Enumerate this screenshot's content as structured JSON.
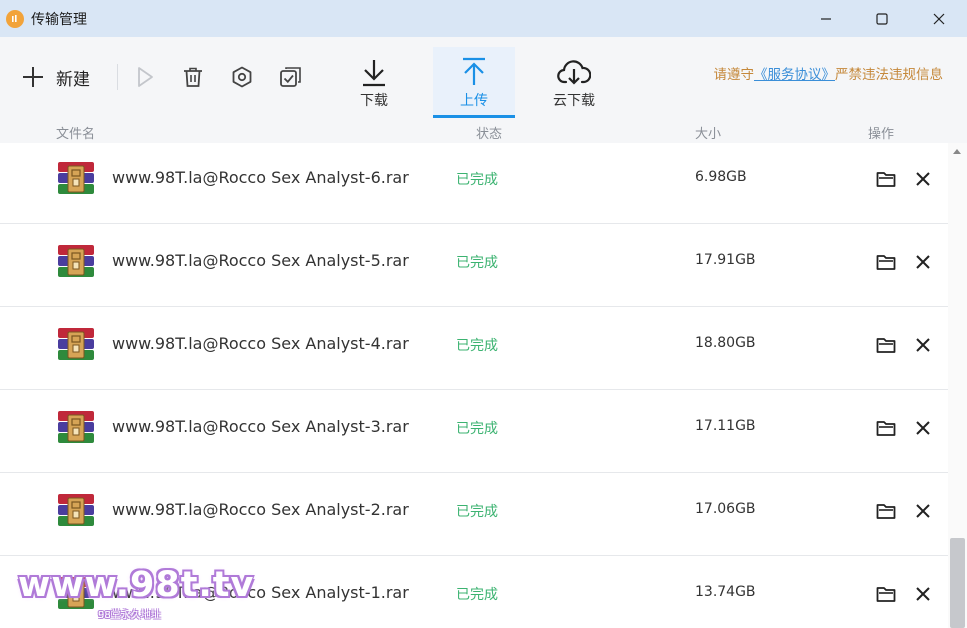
{
  "window": {
    "title": "传输管理",
    "logo_icon": "app-logo-icon",
    "controls": [
      "minimize-icon",
      "maximize-icon",
      "close-icon"
    ]
  },
  "toolbar": {
    "new_label": "新建",
    "actions": [
      "play-icon",
      "trash-icon",
      "settings-icon",
      "check-all-icon"
    ],
    "tabs": [
      {
        "label": "下载",
        "icon": "download-arrow-icon",
        "active": false
      },
      {
        "label": "上传",
        "icon": "upload-arrow-icon",
        "active": true
      },
      {
        "label": "云下载",
        "icon": "cloud-download-icon",
        "active": false
      }
    ],
    "notice_prefix": "请遵守",
    "notice_link": "《服务协议》",
    "notice_suffix": "严禁违法违规信息"
  },
  "columns": {
    "name": "文件名",
    "status": "状态",
    "size": "大小",
    "actions": "操作"
  },
  "files": [
    {
      "name": "www.98T.la@Rocco Sex Analyst-6.rar",
      "status": "已完成",
      "size": "6.98GB"
    },
    {
      "name": "www.98T.la@Rocco Sex Analyst-5.rar",
      "status": "已完成",
      "size": "17.91GB"
    },
    {
      "name": "www.98T.la@Rocco Sex Analyst-4.rar",
      "status": "已完成",
      "size": "18.80GB"
    },
    {
      "name": "www.98T.la@Rocco Sex Analyst-3.rar",
      "status": "已完成",
      "size": "17.11GB"
    },
    {
      "name": "www.98T.la@Rocco Sex Analyst-2.rar",
      "status": "已完成",
      "size": "17.06GB"
    },
    {
      "name": "www.98T.la@Rocco Sex Analyst-1.rar",
      "status": "已完成",
      "size": "13.74GB"
    }
  ],
  "watermark": {
    "text": "www.98t.tv",
    "sub": "98堂永久地址"
  },
  "colors": {
    "accent": "#1a90e6",
    "status_done": "#3cb371",
    "notice": "#c5883a",
    "titlebar": "#d9e6f5"
  }
}
